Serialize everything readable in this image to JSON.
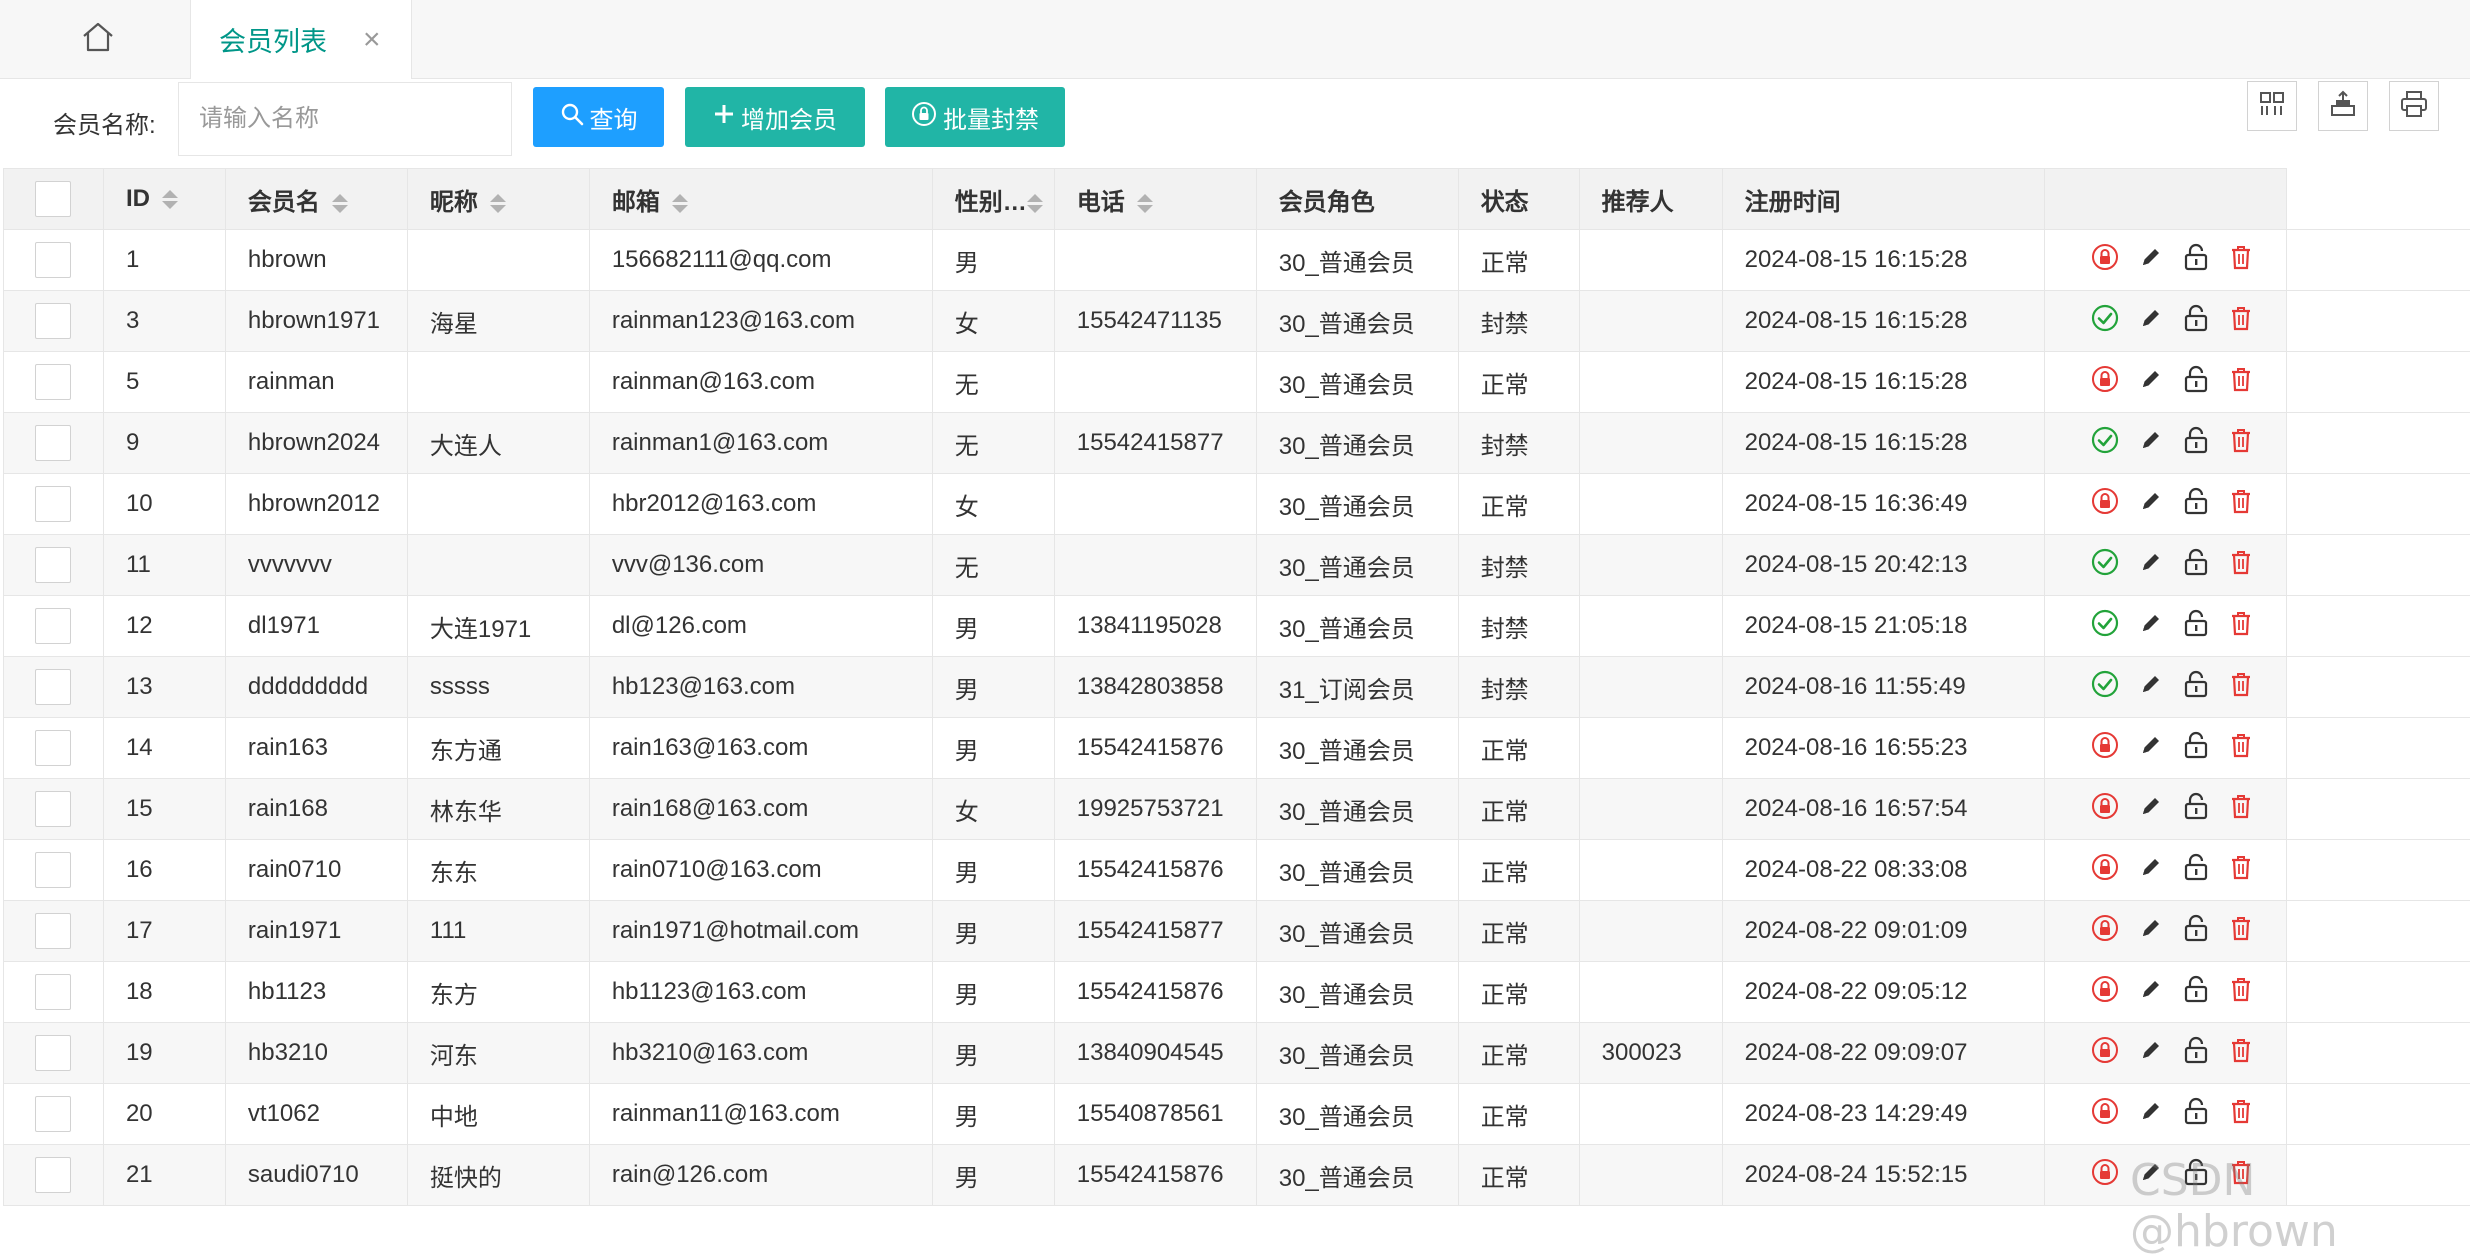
{
  "tabs": {
    "active_label": "会员列表",
    "close_glyph": "×"
  },
  "toolbar": {
    "name_label": "会员名称:",
    "name_placeholder": "请输入名称",
    "query_label": "查询",
    "add_label": "增加会员",
    "ban_label": "批量封禁"
  },
  "table": {
    "headers": {
      "id": "ID",
      "username": "会员名",
      "nickname": "昵称",
      "email": "邮箱",
      "gender": "性别…",
      "phone": "电话",
      "role": "会员角色",
      "status": "状态",
      "referrer": "推荐人",
      "regtime": "注册时间"
    },
    "rows": [
      {
        "id": "1",
        "username": "hbrown",
        "nickname": "",
        "email": "156682111@qq.com",
        "gender": "男",
        "phone": "",
        "role": "30_普通会员",
        "status": "正常",
        "referrer": "",
        "regtime": "2024-08-15 16:15:28",
        "state_icon": "lock-icon"
      },
      {
        "id": "3",
        "username": "hbrown1971",
        "nickname": "海星",
        "email": "rainman123@163.com",
        "gender": "女",
        "phone": "15542471135",
        "role": "30_普通会员",
        "status": "封禁",
        "referrer": "",
        "regtime": "2024-08-15 16:15:28",
        "state_icon": "check-circle-icon"
      },
      {
        "id": "5",
        "username": "rainman",
        "nickname": "",
        "email": "rainman@163.com",
        "gender": "无",
        "phone": "",
        "role": "30_普通会员",
        "status": "正常",
        "referrer": "",
        "regtime": "2024-08-15 16:15:28",
        "state_icon": "lock-icon"
      },
      {
        "id": "9",
        "username": "hbrown2024",
        "nickname": "大连人",
        "email": "rainman1@163.com",
        "gender": "无",
        "phone": "15542415877",
        "role": "30_普通会员",
        "status": "封禁",
        "referrer": "",
        "regtime": "2024-08-15 16:15:28",
        "state_icon": "check-circle-icon"
      },
      {
        "id": "10",
        "username": "hbrown2012",
        "nickname": "",
        "email": "hbr2012@163.com",
        "gender": "女",
        "phone": "",
        "role": "30_普通会员",
        "status": "正常",
        "referrer": "",
        "regtime": "2024-08-15 16:36:49",
        "state_icon": "lock-icon"
      },
      {
        "id": "11",
        "username": "vvvvvvv",
        "nickname": "",
        "email": "vvv@136.com",
        "gender": "无",
        "phone": "",
        "role": "30_普通会员",
        "status": "封禁",
        "referrer": "",
        "regtime": "2024-08-15 20:42:13",
        "state_icon": "check-circle-icon"
      },
      {
        "id": "12",
        "username": "dl1971",
        "nickname": "大连1971",
        "email": "dl@126.com",
        "gender": "男",
        "phone": "13841195028",
        "role": "30_普通会员",
        "status": "封禁",
        "referrer": "",
        "regtime": "2024-08-15 21:05:18",
        "state_icon": "check-circle-icon"
      },
      {
        "id": "13",
        "username": "ddddddddd",
        "nickname": "sssss",
        "email": "hb123@163.com",
        "gender": "男",
        "phone": "13842803858",
        "role": "31_订阅会员",
        "status": "封禁",
        "referrer": "",
        "regtime": "2024-08-16 11:55:49",
        "state_icon": "check-circle-icon"
      },
      {
        "id": "14",
        "username": "rain163",
        "nickname": "东方通",
        "email": "rain163@163.com",
        "gender": "男",
        "phone": "15542415876",
        "role": "30_普通会员",
        "status": "正常",
        "referrer": "",
        "regtime": "2024-08-16 16:55:23",
        "state_icon": "lock-icon"
      },
      {
        "id": "15",
        "username": "rain168",
        "nickname": "林东华",
        "email": "rain168@163.com",
        "gender": "女",
        "phone": "19925753721",
        "role": "30_普通会员",
        "status": "正常",
        "referrer": "",
        "regtime": "2024-08-16 16:57:54",
        "state_icon": "lock-icon"
      },
      {
        "id": "16",
        "username": "rain0710",
        "nickname": "东东",
        "email": "rain0710@163.com",
        "gender": "男",
        "phone": "15542415876",
        "role": "30_普通会员",
        "status": "正常",
        "referrer": "",
        "regtime": "2024-08-22 08:33:08",
        "state_icon": "lock-icon"
      },
      {
        "id": "17",
        "username": "rain1971",
        "nickname": "111",
        "email": "rain1971@hotmail.com",
        "gender": "男",
        "phone": "15542415877",
        "role": "30_普通会员",
        "status": "正常",
        "referrer": "",
        "regtime": "2024-08-22 09:01:09",
        "state_icon": "lock-icon"
      },
      {
        "id": "18",
        "username": "hb1123",
        "nickname": "东方",
        "email": "hb1123@163.com",
        "gender": "男",
        "phone": "15542415876",
        "role": "30_普通会员",
        "status": "正常",
        "referrer": "",
        "regtime": "2024-08-22 09:05:12",
        "state_icon": "lock-icon"
      },
      {
        "id": "19",
        "username": "hb3210",
        "nickname": "河东",
        "email": "hb3210@163.com",
        "gender": "男",
        "phone": "13840904545",
        "role": "30_普通会员",
        "status": "正常",
        "referrer": "300023",
        "regtime": "2024-08-22 09:09:07",
        "state_icon": "lock-icon"
      },
      {
        "id": "20",
        "username": "vt1062",
        "nickname": "中地",
        "email": "rainman11@163.com",
        "gender": "男",
        "phone": "15540878561",
        "role": "30_普通会员",
        "status": "正常",
        "referrer": "",
        "regtime": "2024-08-23 14:29:49",
        "state_icon": "lock-icon"
      },
      {
        "id": "21",
        "username": "saudi0710",
        "nickname": "挺快的",
        "email": "rain@126.com",
        "gender": "男",
        "phone": "15542415876",
        "role": "30_普通会员",
        "status": "正常",
        "referrer": "",
        "regtime": "2024-08-24 15:52:15",
        "state_icon": "lock-icon"
      }
    ]
  },
  "watermark": "CSDN @hbrown",
  "colors": {
    "tab_active": "#009688",
    "btn_blue": "#1E9FFF",
    "btn_teal": "#21B5A6",
    "ok_green": "#22a33a",
    "danger_red": "#e53935"
  }
}
